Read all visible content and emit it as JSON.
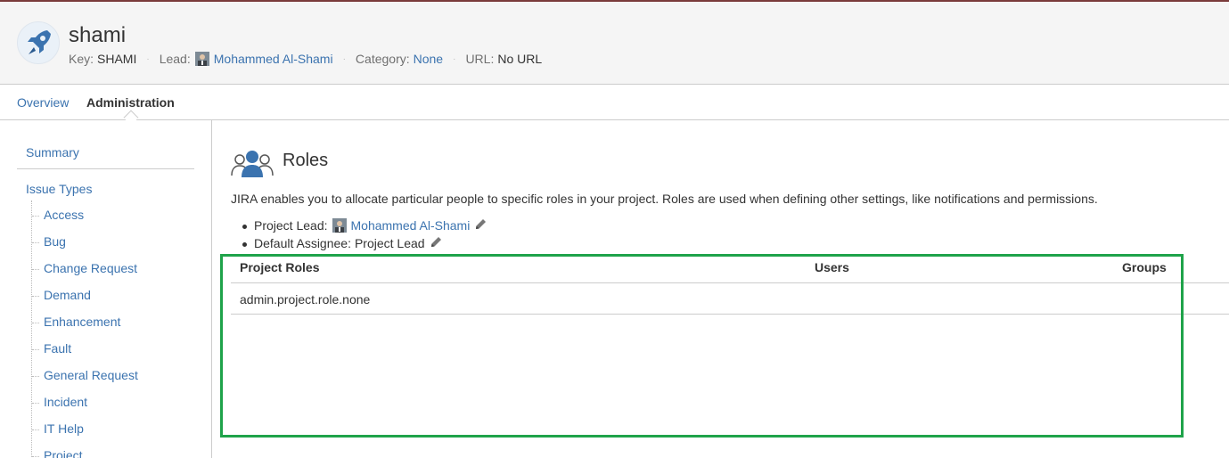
{
  "project": {
    "name": "shami",
    "key_label": "Key:",
    "key_value": "SHAMI",
    "lead_label": "Lead:",
    "lead_name": "Mohammed Al-Shami",
    "category_label": "Category:",
    "category_value": "None",
    "url_label": "URL:",
    "url_value": "No URL",
    "avatar_icon": "rocket-icon",
    "separator": "·"
  },
  "tabs": [
    {
      "label": "Overview",
      "active": false
    },
    {
      "label": "Administration",
      "active": true
    }
  ],
  "sidebar": {
    "summary": "Summary",
    "issue_types": "Issue Types",
    "items": [
      "Access",
      "Bug",
      "Change Request",
      "Demand",
      "Enhancement",
      "Fault",
      "General Request",
      "Incident",
      "IT Help",
      "Project"
    ]
  },
  "roles": {
    "title": "Roles",
    "icon": "users-icon",
    "description": "JIRA enables you to allocate particular people to specific roles in your project. Roles are used when defining other settings, like notifications and permissions.",
    "project_lead_label": "Project Lead:",
    "project_lead_name": "Mohammed Al-Shami",
    "default_assignee_label": "Default Assignee:",
    "default_assignee_value": "Project Lead"
  },
  "table": {
    "headers": [
      "Project Roles",
      "Users",
      "Groups"
    ],
    "rows": [
      [
        "admin.project.role.none",
        "",
        ""
      ]
    ]
  },
  "colors": {
    "link": "#3b73af",
    "highlight": "#1fa34a"
  }
}
